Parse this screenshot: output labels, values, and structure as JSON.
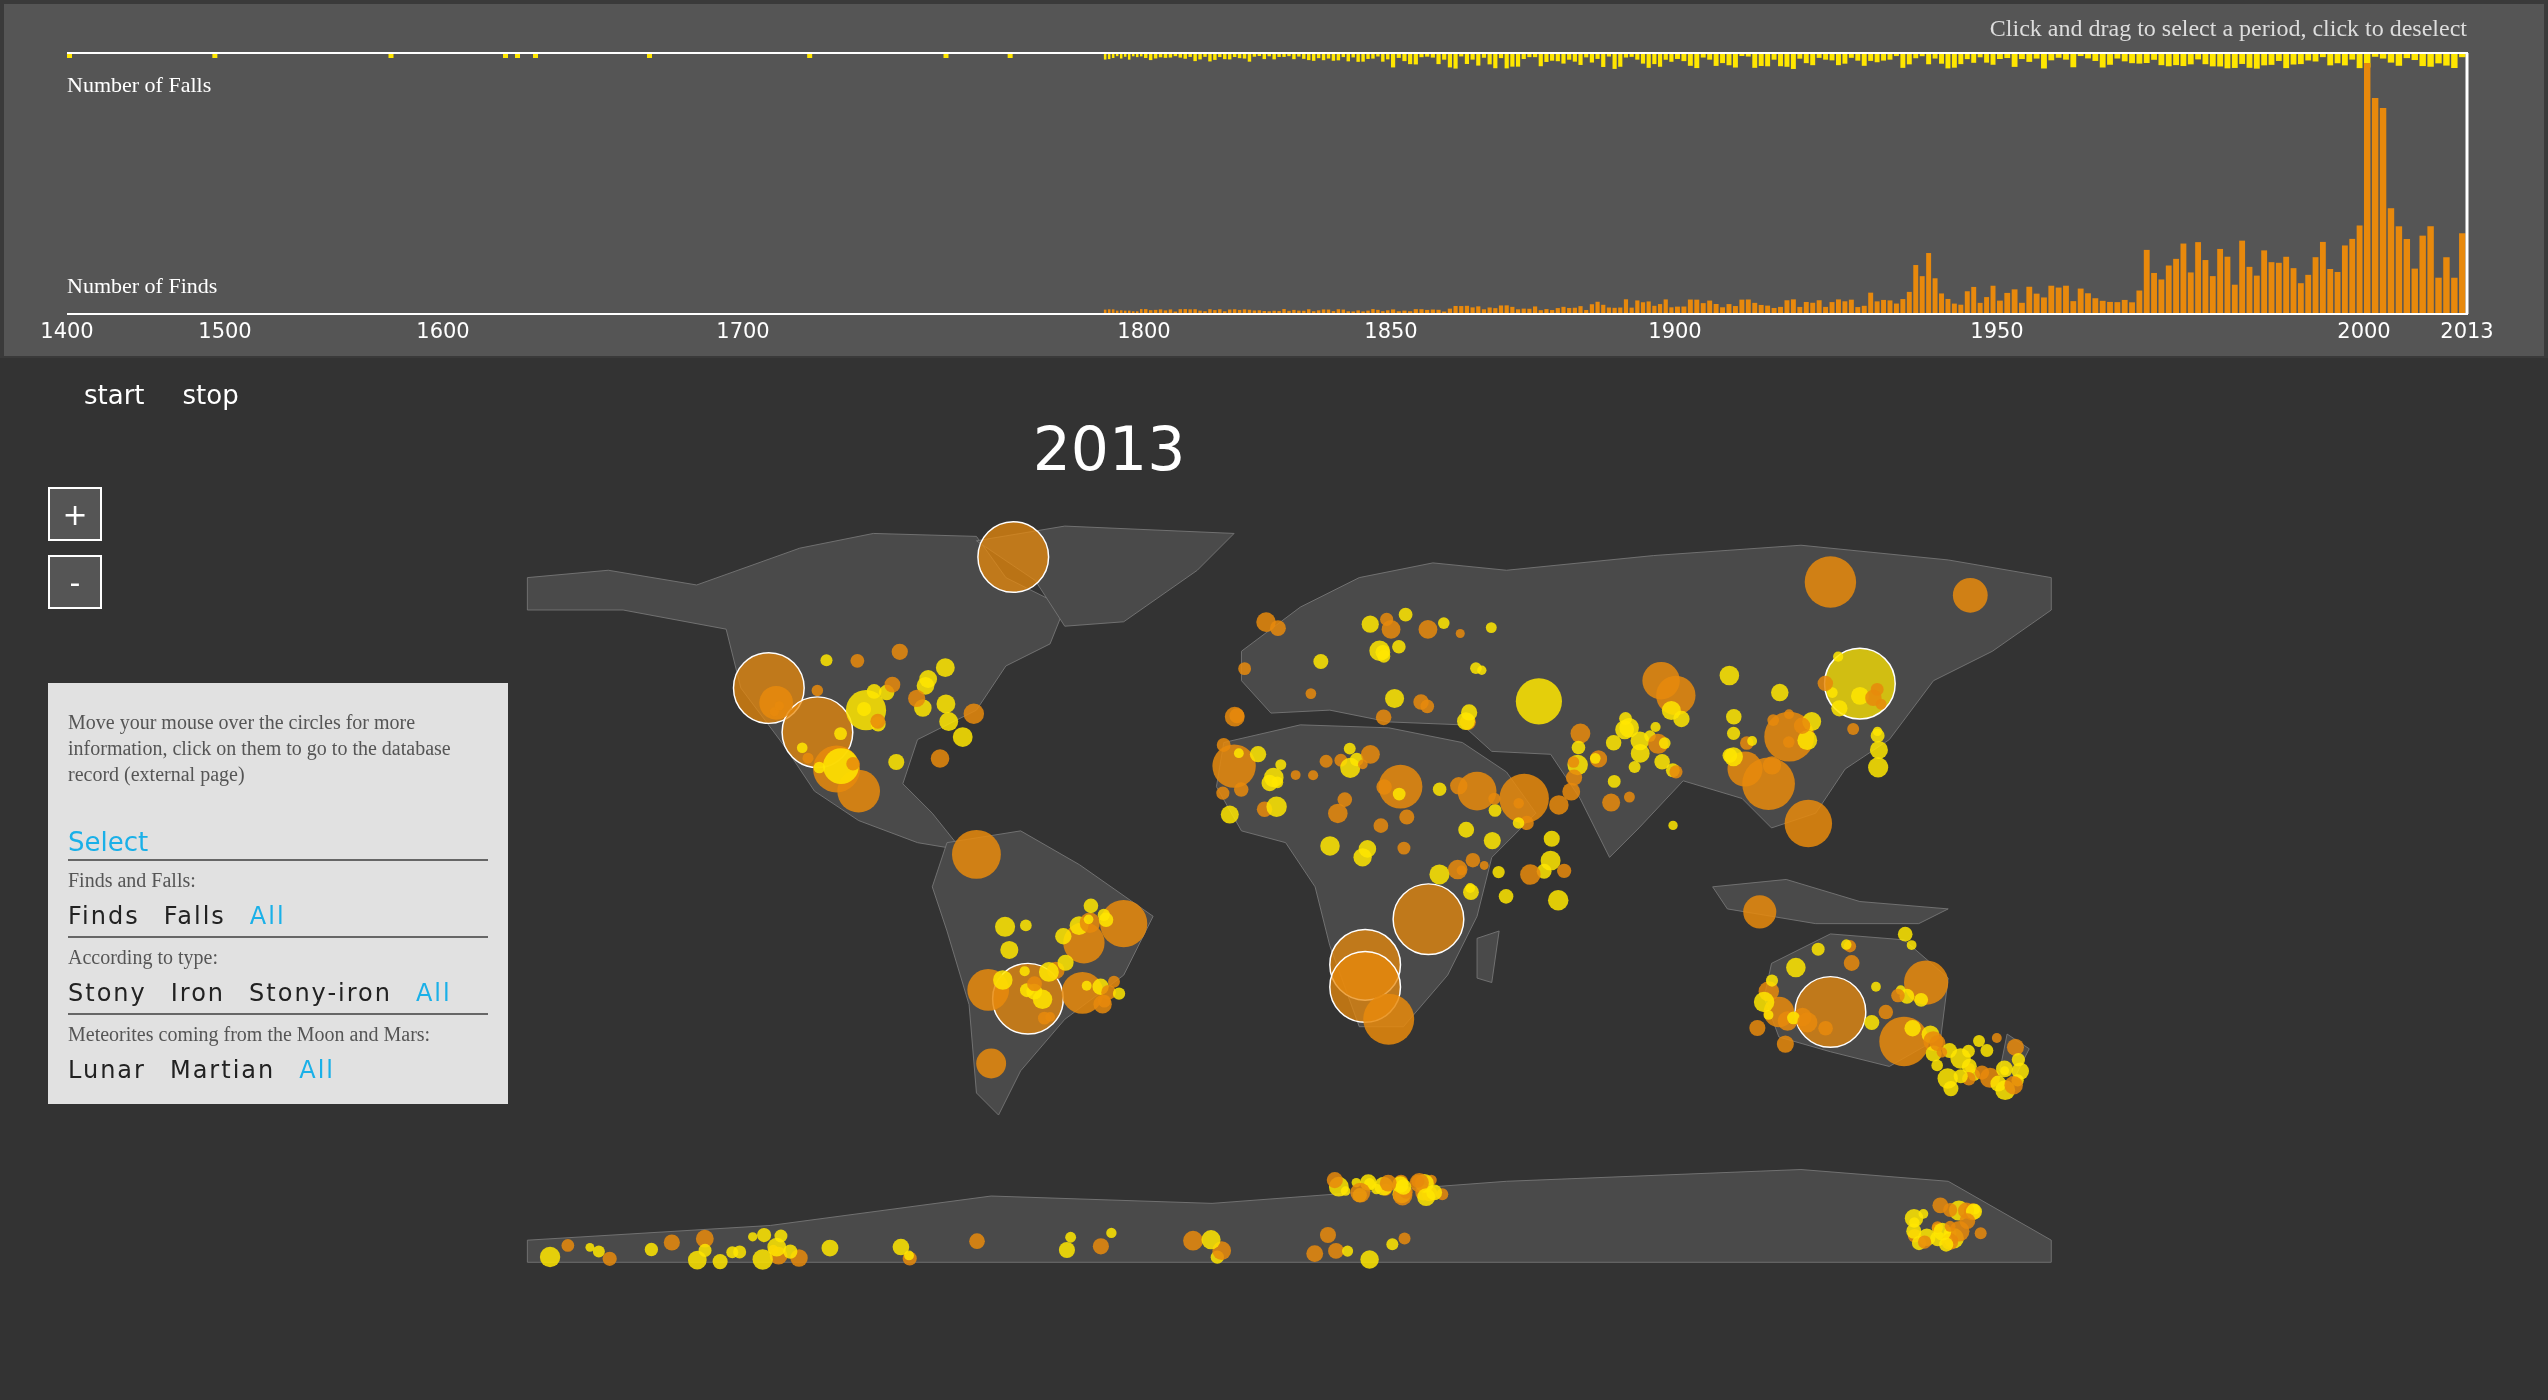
{
  "timeline": {
    "hint": "Click and drag to select a period, click to deselect",
    "falls_label": "Number of Falls",
    "finds_label": "Number of Finds",
    "axis_ticks": [
      "1400",
      "1500",
      "1600",
      "1700",
      "1800",
      "1850",
      "1900",
      "1950",
      "2000",
      "2013"
    ]
  },
  "playback": {
    "buttons": [
      "start",
      "stop"
    ]
  },
  "year": "2013",
  "zoom": {
    "buttons": [
      "+",
      "-"
    ]
  },
  "info": {
    "text": "Move your mouse over the circles for more information, click on them to go to the database record (external page)",
    "select_title": "Select",
    "groups": [
      {
        "title": "Finds and Falls:",
        "options": [
          {
            "label": "Finds",
            "selected": false
          },
          {
            "label": "Falls",
            "selected": false
          },
          {
            "label": "All",
            "selected": true
          }
        ]
      },
      {
        "title": "According to type:",
        "options": [
          {
            "label": "Stony",
            "selected": false
          },
          {
            "label": "Iron",
            "selected": false
          },
          {
            "label": "Stony-iron",
            "selected": false
          },
          {
            "label": "All",
            "selected": true
          }
        ]
      },
      {
        "title": "Meteorites coming from the Moon and Mars:",
        "options": [
          {
            "label": "Lunar",
            "selected": false
          },
          {
            "label": "Martian",
            "selected": false
          },
          {
            "label": "All",
            "selected": true
          }
        ]
      }
    ]
  }
}
